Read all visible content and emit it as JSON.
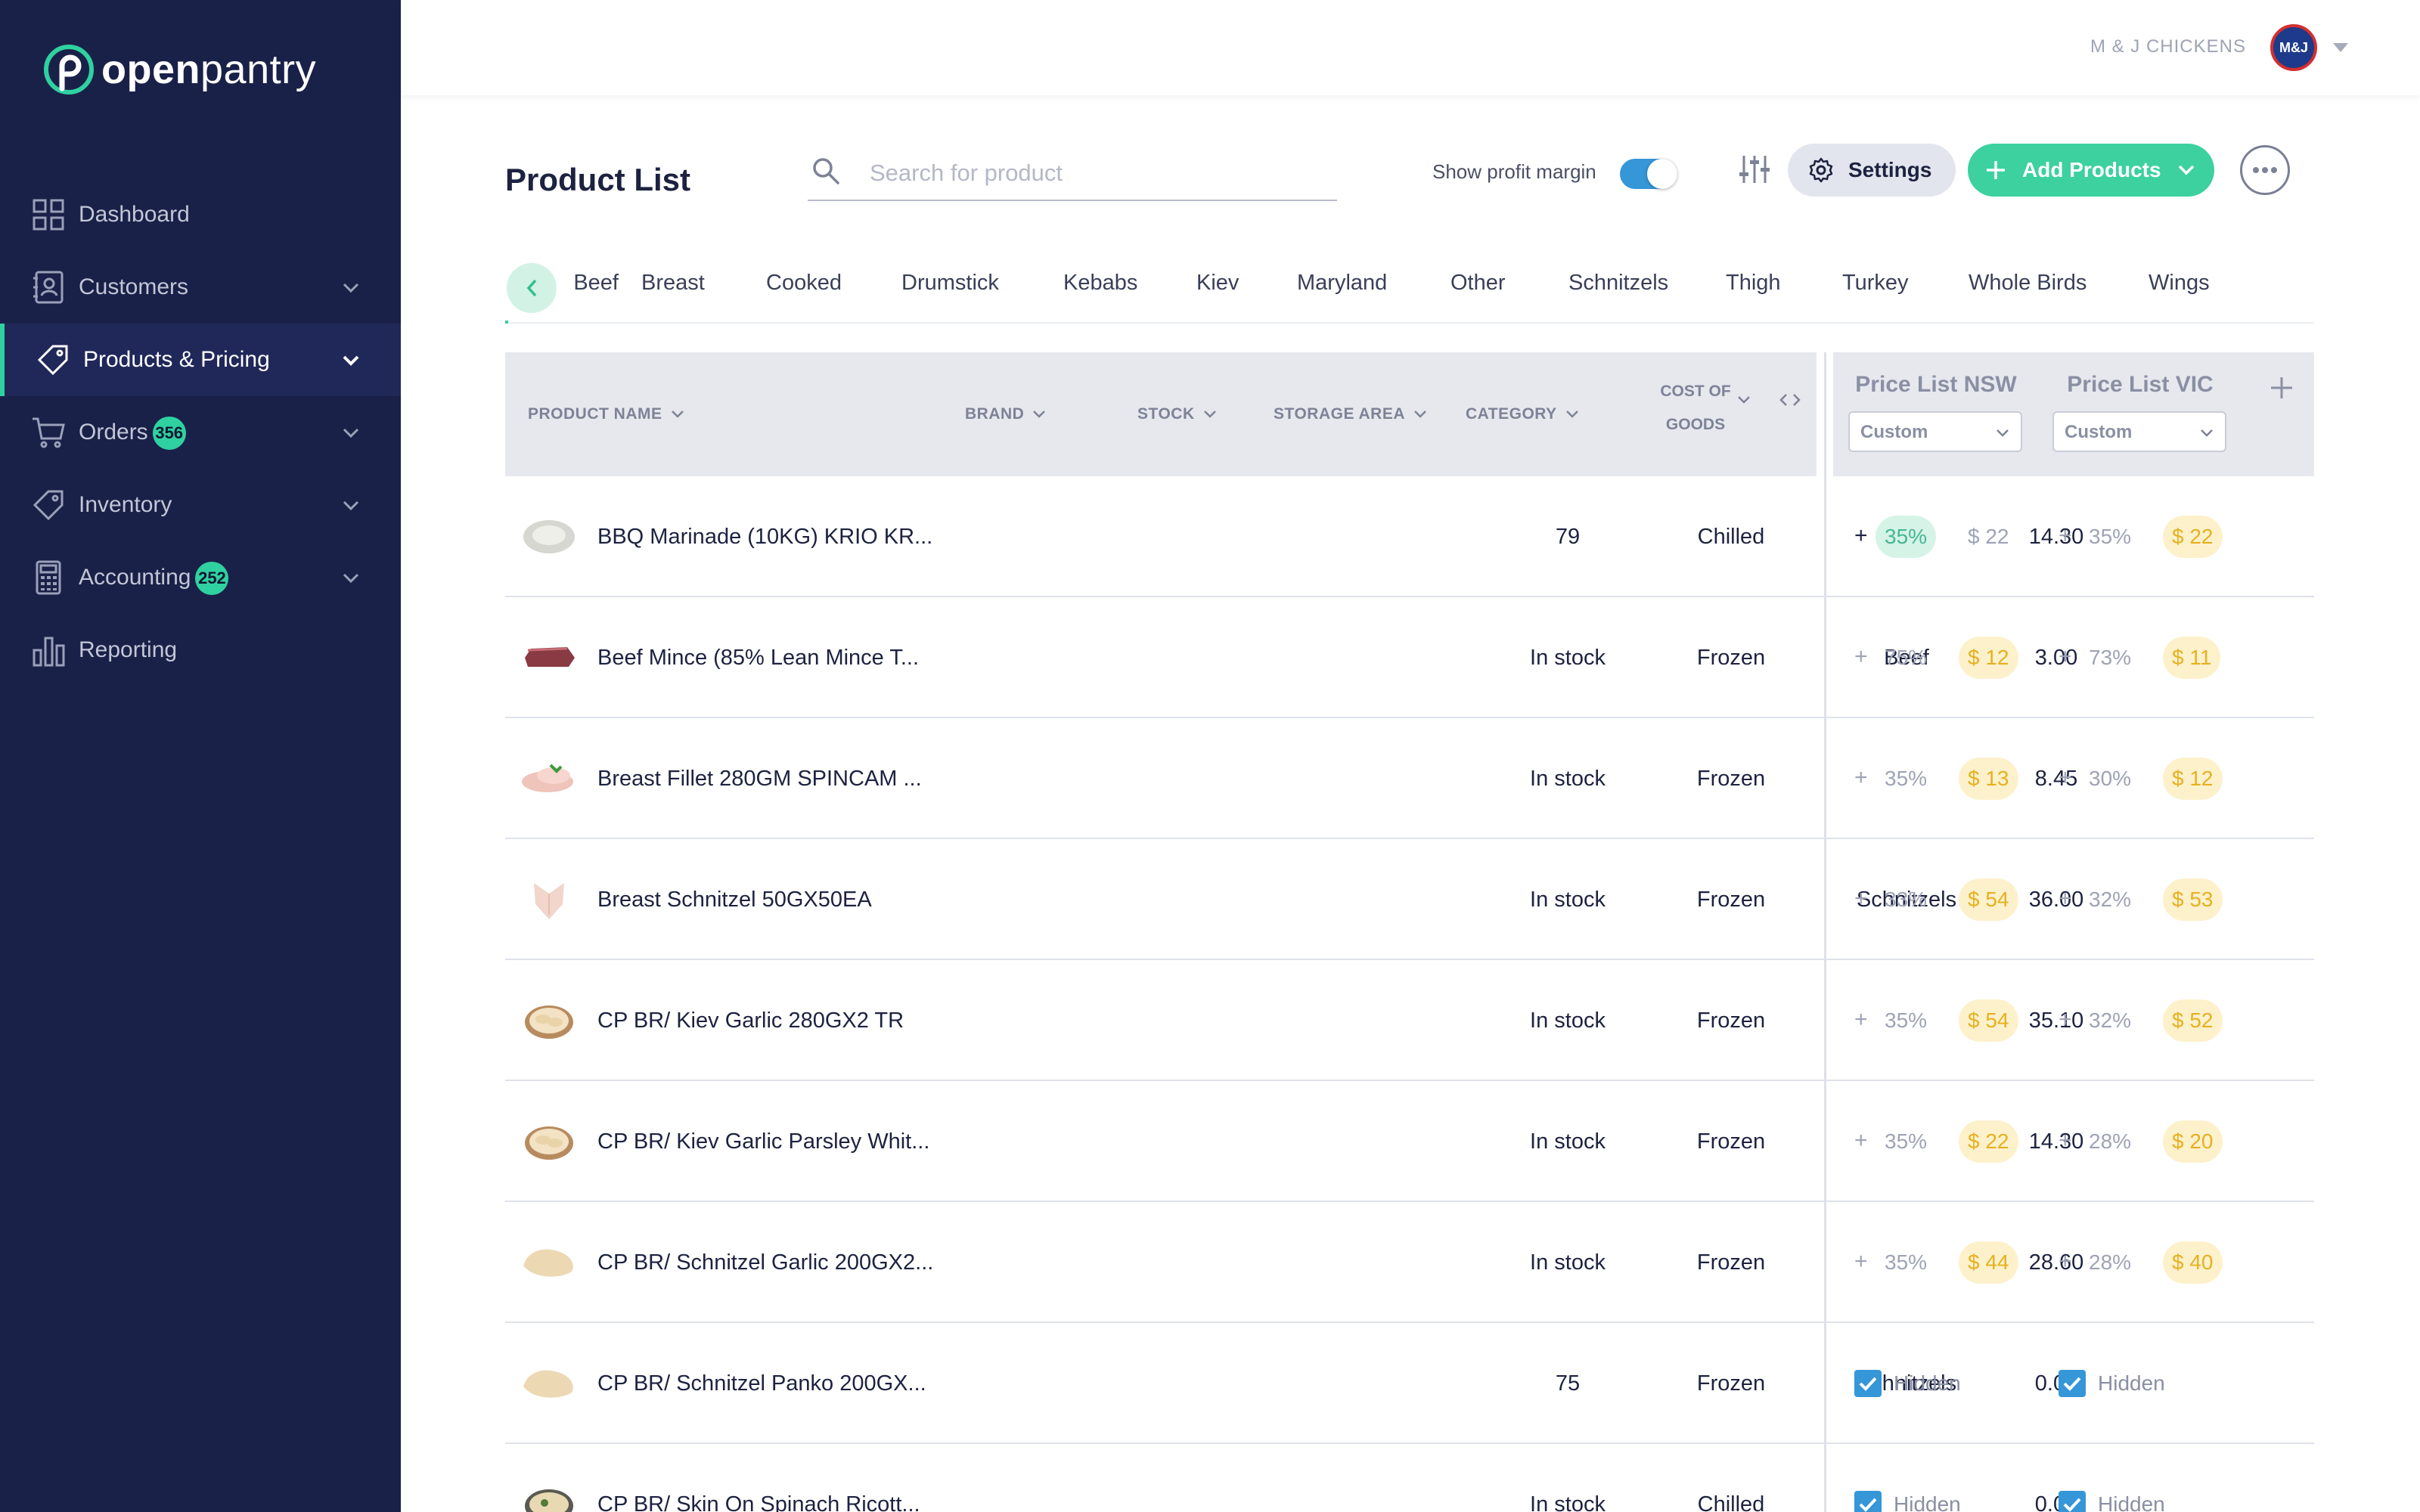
{
  "brand": {
    "name_bold": "open",
    "name_light": "pantry"
  },
  "sidebar": {
    "items": [
      {
        "label": "Dashboard",
        "icon": "dashboard-icon"
      },
      {
        "label": "Customers",
        "icon": "customers-icon"
      },
      {
        "label": "Products & Pricing",
        "icon": "tag-icon",
        "active": true
      },
      {
        "label": "Orders",
        "icon": "cart-icon",
        "badge": "356"
      },
      {
        "label": "Inventory",
        "icon": "tag-icon"
      },
      {
        "label": "Accounting",
        "icon": "calculator-icon",
        "badge": "252"
      },
      {
        "label": "Reporting",
        "icon": "bar-chart-icon"
      }
    ]
  },
  "topbar": {
    "company": "M & J CHICKENS",
    "avatar_text": "M&J"
  },
  "header": {
    "title": "Product List",
    "search_placeholder": "Search for product",
    "margin_toggle_label": "Show profit margin",
    "margin_toggle_on": true,
    "settings_label": "Settings",
    "add_label": "Add Products"
  },
  "tabs": [
    "Beef",
    "Breast",
    "Cooked",
    "Drumstick",
    "Kebabs",
    "Kiev",
    "Maryland",
    "Other",
    "Schnitzels",
    "Thigh",
    "Turkey",
    "Whole Birds",
    "Wings"
  ],
  "table": {
    "columns": {
      "product_name": "PRODUCT NAME",
      "brand": "BRAND",
      "stock": "STOCK",
      "storage": "STORAGE AREA",
      "category": "CATEGORY",
      "cog_line1": "COST OF",
      "cog_line2": "GOODS"
    },
    "price_lists": [
      {
        "name": "Price List NSW",
        "mode": "Custom"
      },
      {
        "name": "Price List VIC",
        "mode": "Custom"
      }
    ],
    "rows": [
      {
        "name": "BBQ Marinade (10KG) KRIO KR...",
        "stock": "79",
        "storage": "Chilled",
        "category": "",
        "cog": "14.30",
        "nsw": {
          "margin": "35%",
          "price": "$ 22"
        },
        "vic": {
          "margin": "35%",
          "price": "$ 22"
        }
      },
      {
        "name": "Beef Mince (85% Lean Mince T...",
        "stock": "In stock",
        "storage": "Frozen",
        "category": "Beef",
        "cog": "3.00",
        "nsw": {
          "margin": "75%",
          "price": "$ 12"
        },
        "vic": {
          "margin": "73%",
          "price": "$ 11"
        }
      },
      {
        "name": "Breast Fillet 280GM SPINCAM ...",
        "stock": "In stock",
        "storage": "Frozen",
        "category": "",
        "cog": "8.45",
        "nsw": {
          "margin": "35%",
          "price": "$ 13"
        },
        "vic": {
          "margin": "30%",
          "price": "$ 12"
        }
      },
      {
        "name": "Breast Schnitzel 50GX50EA",
        "stock": "In stock",
        "storage": "Frozen",
        "category": "Schnitzels",
        "cog": "36.00",
        "nsw": {
          "margin": "33%",
          "price": "$ 54"
        },
        "vic": {
          "margin": "32%",
          "price": "$ 53"
        }
      },
      {
        "name": "CP BR/ Kiev Garlic 280GX2 TR",
        "stock": "In stock",
        "storage": "Frozen",
        "category": "",
        "cog": "35.10",
        "nsw": {
          "margin": "35%",
          "price": "$ 54"
        },
        "vic": {
          "margin": "32%",
          "price": "$ 52"
        }
      },
      {
        "name": "CP BR/ Kiev Garlic Parsley Whit...",
        "stock": "In stock",
        "storage": "Frozen",
        "category": "",
        "cog": "14.30",
        "nsw": {
          "margin": "35%",
          "price": "$ 22"
        },
        "vic": {
          "margin": "28%",
          "price": "$ 20"
        }
      },
      {
        "name": "CP BR/ Schnitzel Garlic 200GX2...",
        "stock": "In stock",
        "storage": "Frozen",
        "category": "",
        "cog": "28.60",
        "nsw": {
          "margin": "35%",
          "price": "$ 44"
        },
        "vic": {
          "margin": "28%",
          "price": "$ 40"
        }
      },
      {
        "name": "CP BR/ Schnitzel Panko 200GX...",
        "stock": "75",
        "storage": "Frozen",
        "category": "Schnitzels",
        "cog": "0.00",
        "nsw": {
          "hidden": "Hidden"
        },
        "vic": {
          "hidden": "Hidden"
        }
      },
      {
        "name": "CP BR/ Skin On Spinach Ricott...",
        "stock": "In stock",
        "storage": "Chilled",
        "category": "",
        "cog": "0.00",
        "nsw": {
          "hidden": "Hidden"
        },
        "vic": {
          "hidden": "Hidden"
        }
      }
    ]
  },
  "colors": {
    "sidebar": "#1a2148",
    "accent": "#3cd19e",
    "toggle": "#3596d8",
    "price_badge": "#fdf1cc"
  }
}
